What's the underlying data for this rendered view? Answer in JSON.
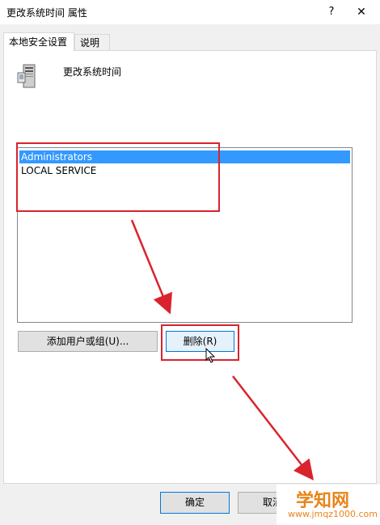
{
  "window": {
    "title": "更改系统时间 属性",
    "help_label": "?",
    "close_label": "✕"
  },
  "tabs": [
    {
      "label": "本地安全设置"
    },
    {
      "label": "说明"
    }
  ],
  "policy": {
    "heading": "更改系统时间",
    "icon": "server-icon"
  },
  "list": {
    "items": [
      {
        "label": "Administrators",
        "selected": true
      },
      {
        "label": "LOCAL SERVICE",
        "selected": false
      }
    ]
  },
  "buttons": {
    "add": "添加用户或组(U)...",
    "remove": "删除(R)",
    "ok": "确定",
    "cancel": "取消"
  },
  "annotation_color": "#d9232d",
  "selection_color": "#3399ff",
  "watermark": {
    "title": "学知网",
    "url": "www.jmqz1000.com",
    "color": "#e8851a"
  }
}
